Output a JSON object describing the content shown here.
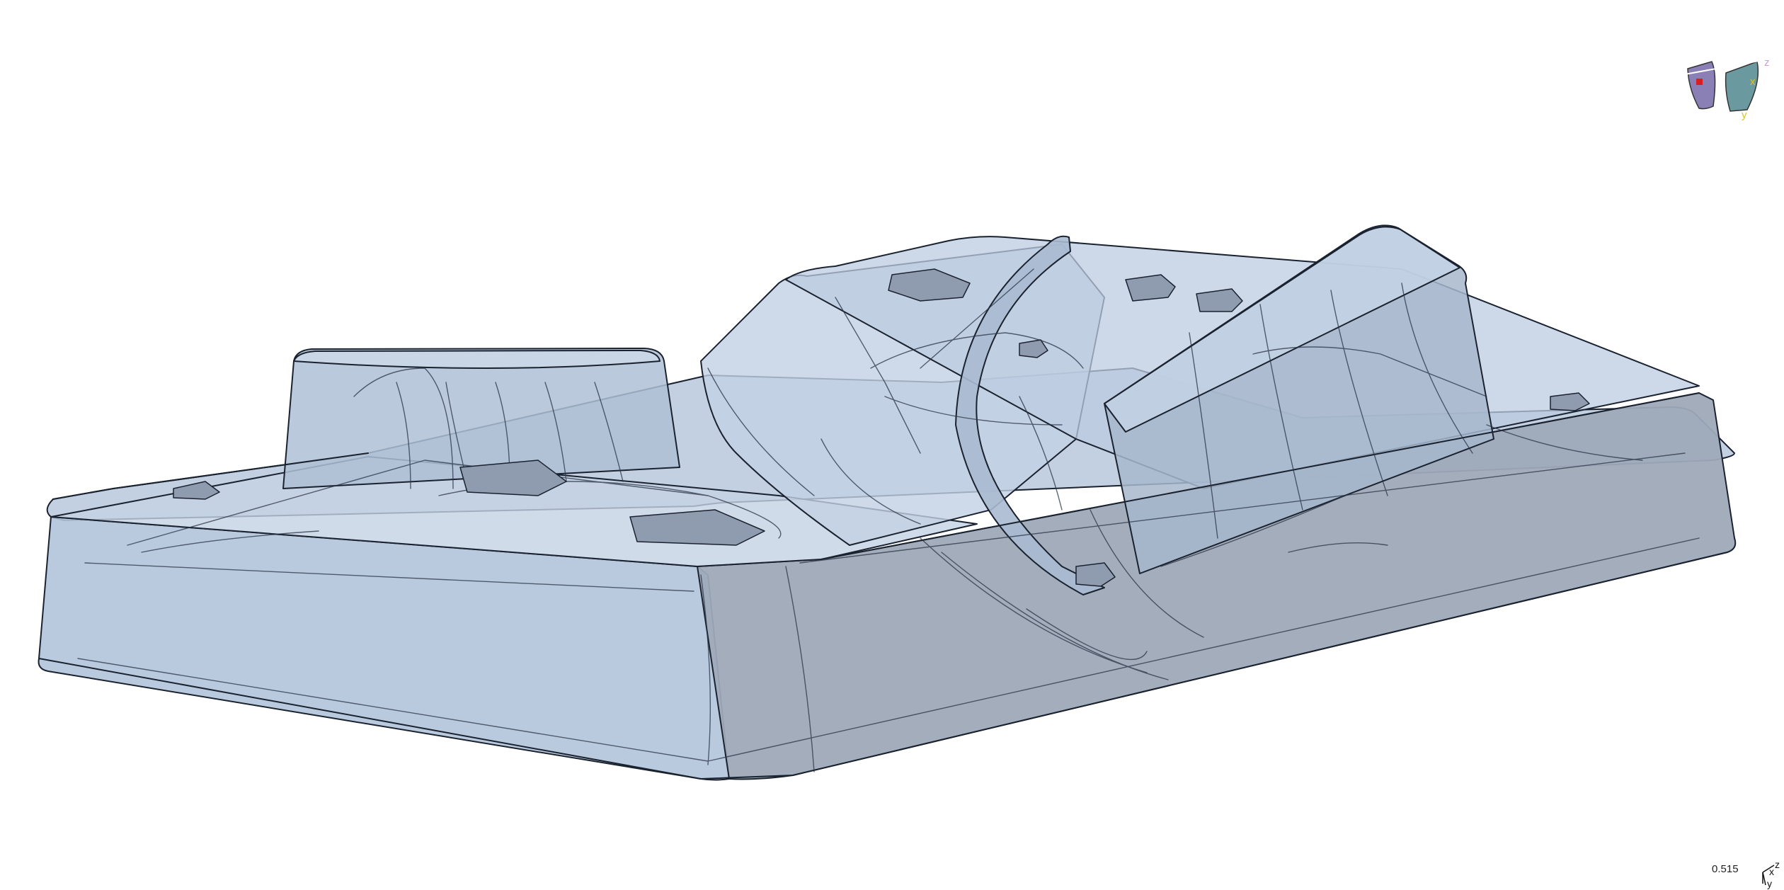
{
  "viewport": {
    "zoom_readout": "0.515",
    "background_color": "#ffffff",
    "model_fill_color": "#b8c8dc",
    "model_edge_color": "#1a2230"
  },
  "orientation_cube": {
    "icon": "view-orientation-icon",
    "labels": {
      "z": "z",
      "x": "x",
      "y": "y"
    },
    "colors": {
      "left_face": "#8a80b6",
      "right_face": "#6a9aa0",
      "marker": "#d81e1e",
      "label": "#e0c020",
      "z_label": "#c8a0e0"
    }
  },
  "axis_triad": {
    "icon": "axis-triad-icon",
    "labels": {
      "x": "x",
      "z": "z",
      "y": "y"
    }
  }
}
